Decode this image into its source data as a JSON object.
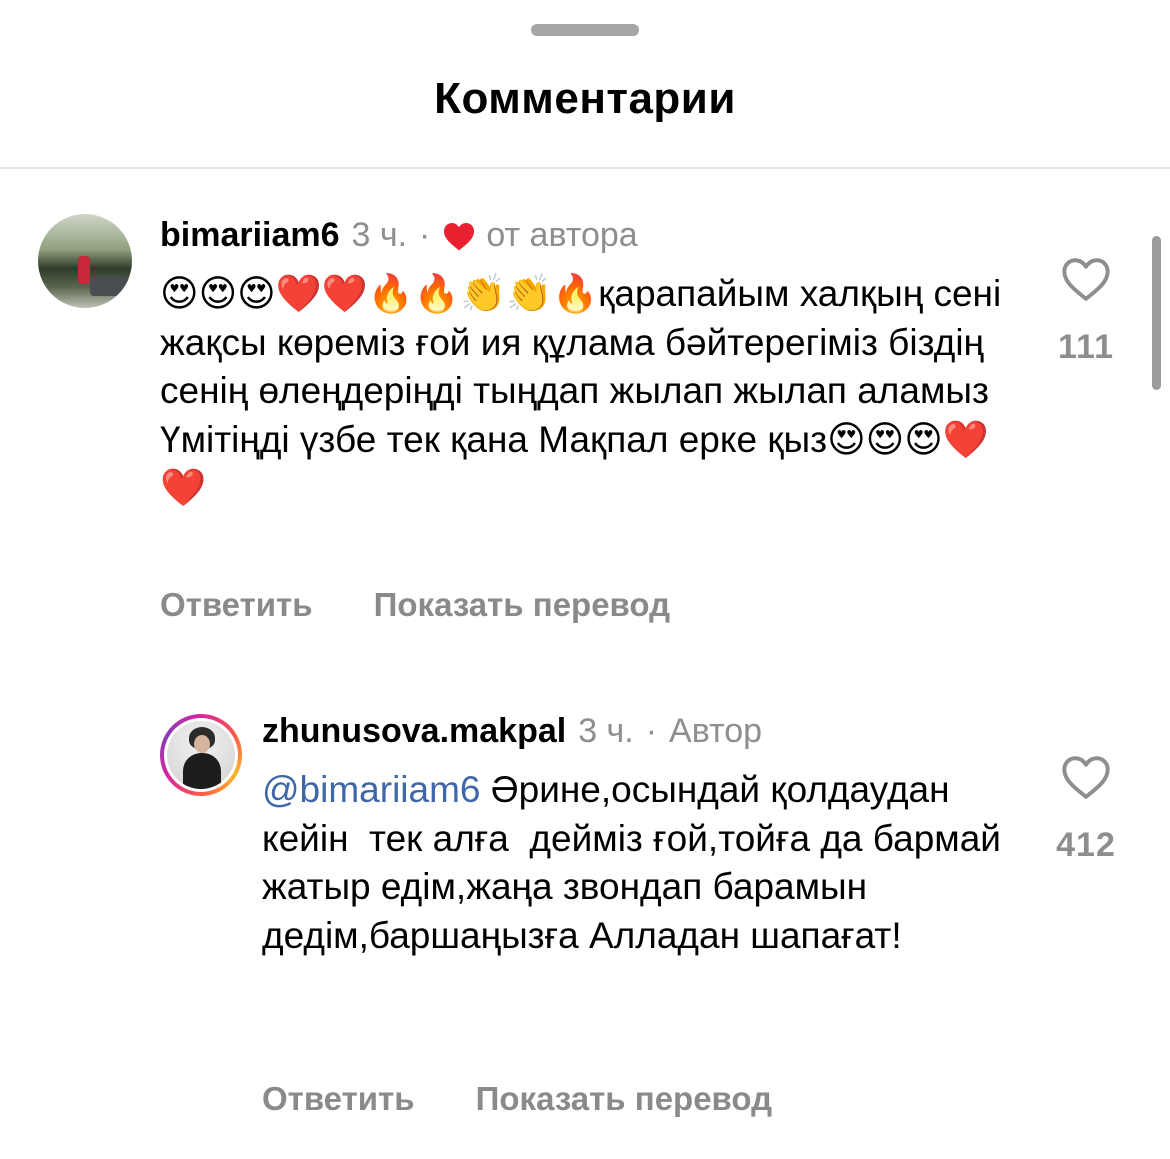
{
  "header": {
    "title": "Комментарии"
  },
  "comments": [
    {
      "username": "bimariiam6",
      "time": "3 ч.",
      "separator": "·",
      "badge": "от автора",
      "badge_icon": "heart-icon",
      "text": "😍😍😍❤️❤️🔥🔥👏👏🔥қарапайым халқың сені жақсы көреміз ғой ия құлама бәйтерегіміз біздің  сенің өлеңдеріңді тыңдап жылап жылап аламыз Үмітіңді үзбе тек қана Мақпал ерке қыз😍😍😍❤️❤️",
      "likes": "111",
      "reply_label": "Ответить",
      "translate_label": "Показать перевод"
    },
    {
      "username": "zhunusova.makpal",
      "time": "3 ч.",
      "separator": "·",
      "badge": "Автор",
      "mention": "@bimariiam6",
      "text": " Әрине,осындай қолдаудан кейін  тек алға  дейміз ғой,тойға да бармай жатыр едім,жаңа звондап барамын дедім,баршаңызға Алладан шапағат!",
      "likes": "412",
      "reply_label": "Ответить",
      "translate_label": "Показать перевод"
    }
  ],
  "colors": {
    "author_heart": "#e8202f",
    "mention": "#3f66a8",
    "secondary_text": "#8e8e8e"
  }
}
